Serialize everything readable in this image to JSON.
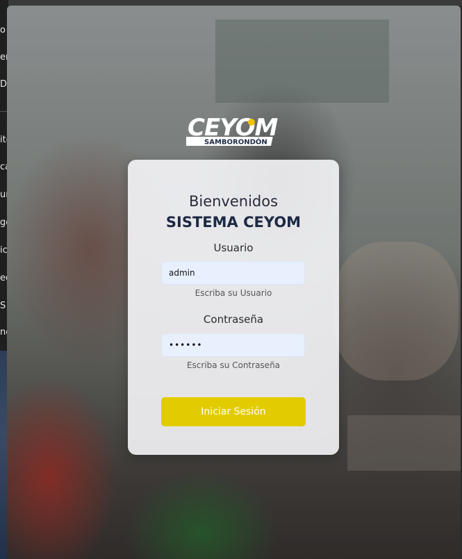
{
  "underlying_window": {
    "sidebar_fragments": [
      "o",
      "eri",
      "D",
      "ite",
      "ca",
      "uı",
      "ge",
      "ic",
      "ed",
      "S",
      "ng"
    ]
  },
  "logo": {
    "brand": "CEYOM",
    "subtitle": "SAMBORONDÓN"
  },
  "login": {
    "welcome": "Bienvenidos",
    "system_title": "SISTEMA CEYOM",
    "username": {
      "label": "Usuario",
      "value": "admin",
      "hint": "Escriba su Usuario"
    },
    "password": {
      "label": "Contraseña",
      "value": "••••••",
      "hint": "Escriba su Contraseña"
    },
    "submit_label": "Iniciar Sesión"
  },
  "colors": {
    "button": "#e2cc00",
    "input_bg": "#e8f0fe",
    "title": "#1d2a44"
  }
}
